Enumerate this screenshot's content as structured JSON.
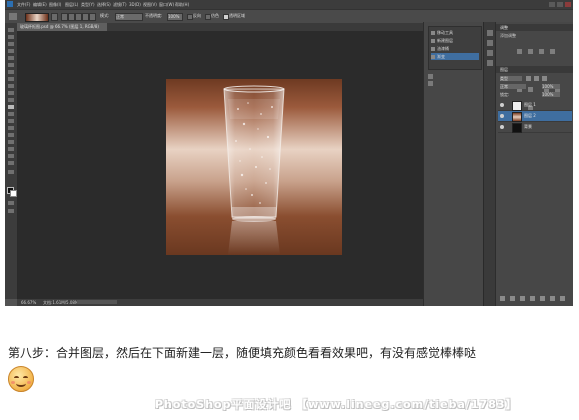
{
  "menubar": {
    "items": [
      "文件(F)",
      "编辑(E)",
      "图像(I)",
      "图层(L)",
      "类型(Y)",
      "选择(S)",
      "滤镜(T)",
      "3D(D)",
      "视图(V)",
      "窗口(W)",
      "帮助(H)"
    ]
  },
  "options_bar": {
    "mode_label": "模式:",
    "mode_value": "正常",
    "opacity_label": "不透明度:",
    "opacity_value": "100%",
    "reverse_label": "反向",
    "dither_label": "仿色",
    "transparency_label": "透明区域"
  },
  "document": {
    "tab_title": "玻璃杯抠图.psd @ 66.7% (图层 1, RGB/8)",
    "zoom": "66.67%",
    "doc_info": "文档:1.61M/5.08M"
  },
  "history_panel": {
    "items": [
      "移动工具",
      "新建图层",
      "油漆桶",
      "渐变"
    ]
  },
  "adjustments_panel": {
    "title": "调整",
    "subtitle": "添加调整"
  },
  "layers_panel": {
    "title": "图层",
    "filter_label": "类型",
    "blend_mode": "正常",
    "opacity_value": "100%",
    "lock_label": "锁定:",
    "fill_value": "100%",
    "layers": [
      {
        "name": "图层 1",
        "thumb": "#eeeeee",
        "active": false
      },
      {
        "name": "图层 2",
        "thumb": "#b06a45",
        "active": true
      },
      {
        "name": "背景",
        "thumb": "#111111",
        "active": false
      }
    ]
  },
  "caption": "第八步：合并图层，然后在下面新建一层，随便填充颜色看看效果吧，有没有感觉棒棒哒",
  "watermark": "PhotoShop平面设计吧 【www.lineeg.com/tieba/1783】",
  "colors": {
    "canvas_top": "#6e3a22",
    "canvas_mid": "#e8d2c3",
    "canvas_bottom": "#6a3820",
    "workspace": "#2b2b2b",
    "selection": "#3f6ea0"
  }
}
